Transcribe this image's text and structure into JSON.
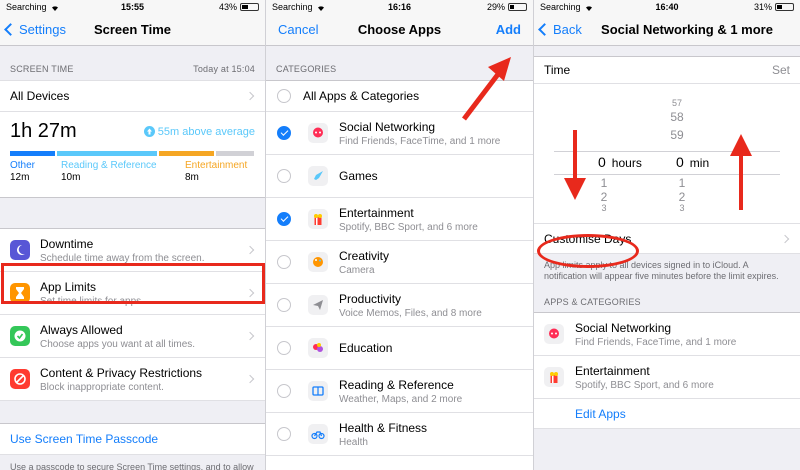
{
  "panel1": {
    "status": {
      "carrier": "Searching",
      "time": "15:55",
      "battery": "43%"
    },
    "nav": {
      "back": "Settings",
      "title": "Screen Time"
    },
    "section": {
      "label": "SCREEN TIME",
      "date": "Today at 15:04"
    },
    "all_devices": "All Devices",
    "usage": {
      "total": "1h 27m",
      "trend": "55m above average"
    },
    "categories": [
      {
        "name": "Other",
        "time": "12m",
        "color": "#147efb",
        "fraction": 0.19
      },
      {
        "name": "Reading & Reference",
        "time": "10m",
        "color": "#5ac8fa",
        "fraction": 0.42
      },
      {
        "name": "Entertainment",
        "time": "8m",
        "color": "#f5a623",
        "fraction": 0.23
      }
    ],
    "menu": [
      {
        "title": "Downtime",
        "subtitle": "Schedule time away from the screen.",
        "icon": "moon-icon",
        "color": "#5856d6"
      },
      {
        "title": "App Limits",
        "subtitle": "Set time limits for apps.",
        "icon": "hourglass-icon",
        "color": "#ff9500"
      },
      {
        "title": "Always Allowed",
        "subtitle": "Choose apps you want at all times.",
        "icon": "checkmark-icon",
        "color": "#34c759"
      },
      {
        "title": "Content & Privacy Restrictions",
        "subtitle": "Block inappropriate content.",
        "icon": "no-entry-icon",
        "color": "#ff3b30"
      }
    ],
    "passcode_link": "Use Screen Time Passcode",
    "passcode_footer": "Use a passcode to secure Screen Time settings, and to allow for more time when limits expire."
  },
  "panel2": {
    "status": {
      "carrier": "Searching",
      "time": "16:16",
      "battery": "29%"
    },
    "nav": {
      "cancel": "Cancel",
      "title": "Choose Apps",
      "add": "Add"
    },
    "section_label": "CATEGORIES",
    "all_label": "All Apps & Categories",
    "categories": [
      {
        "name": "Social Networking",
        "detail": "Find Friends, FaceTime, and 1 more",
        "checked": true,
        "icon": "chat-bubble-icon",
        "color": "#ff2d55"
      },
      {
        "name": "Games",
        "detail": "",
        "checked": false,
        "icon": "rocket-icon",
        "color": "#5ac8fa"
      },
      {
        "name": "Entertainment",
        "detail": "Spotify, BBC Sport, and 6 more",
        "checked": true,
        "icon": "popcorn-icon",
        "color": "#ff3b30"
      },
      {
        "name": "Creativity",
        "detail": "Camera",
        "checked": false,
        "icon": "palette-icon",
        "color": "#ff9500"
      },
      {
        "name": "Productivity",
        "detail": "Voice Memos, Files, and 8 more",
        "checked": false,
        "icon": "paper-plane-icon",
        "color": "#8e8e93"
      },
      {
        "name": "Education",
        "detail": "",
        "checked": false,
        "icon": "education-icon",
        "color": "#af52de"
      },
      {
        "name": "Reading & Reference",
        "detail": "Weather, Maps, and 2 more",
        "checked": false,
        "icon": "book-icon",
        "color": "#147efb"
      },
      {
        "name": "Health & Fitness",
        "detail": "Health",
        "checked": false,
        "icon": "bicycle-icon",
        "color": "#147efb"
      }
    ]
  },
  "panel3": {
    "status": {
      "carrier": "Searching",
      "time": "16:40",
      "battery": "31%"
    },
    "nav": {
      "back": "Back",
      "title": "Social Networking & 1 more"
    },
    "time_label": "Time",
    "set_label": "Set",
    "picker": {
      "hours_above": [],
      "mins_above": [
        "57",
        "58",
        "59"
      ],
      "hours_value": "0",
      "hours_unit": "hours",
      "mins_value": "0",
      "mins_unit": "min",
      "hours_below": [
        "1",
        "2",
        "3"
      ],
      "mins_below": [
        "1",
        "2",
        "3"
      ]
    },
    "customise_days": "Customise Days",
    "info": "App limits apply to all devices signed in to iCloud. A notification will appear five minutes before the limit expires.",
    "section_label": "APPS & CATEGORIES",
    "items": [
      {
        "name": "Social Networking",
        "detail": "Find Friends, FaceTime, and 1 more",
        "icon": "chat-bubble-icon",
        "color": "#ff2d55"
      },
      {
        "name": "Entertainment",
        "detail": "Spotify, BBC Sport, and 6 more",
        "icon": "popcorn-icon",
        "color": "#ff3b30"
      }
    ],
    "edit_apps": "Edit Apps"
  }
}
